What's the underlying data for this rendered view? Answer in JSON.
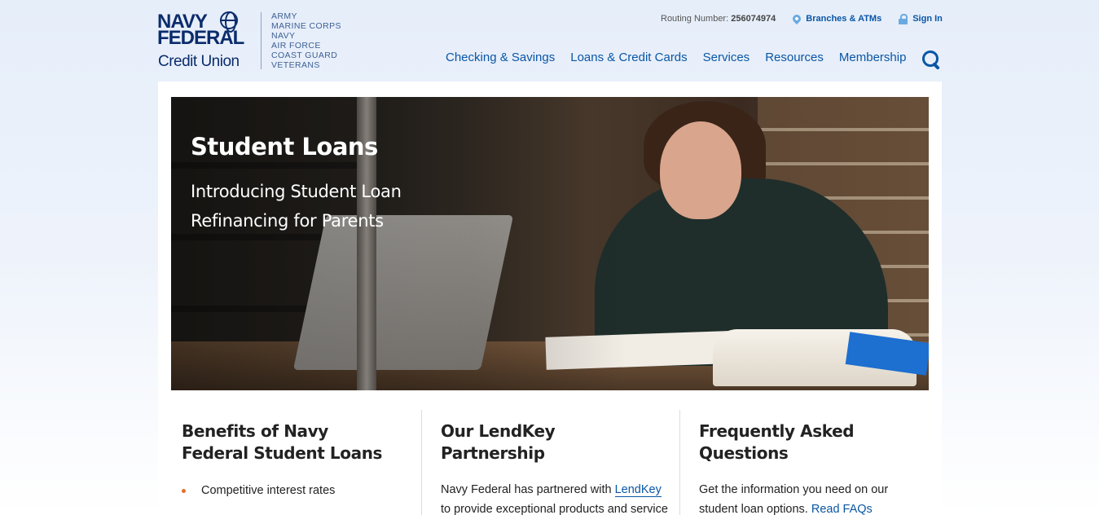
{
  "logo": {
    "line1": "NAVY",
    "line2": "FEDERAL",
    "line3": "Credit Union",
    "branches": [
      "ARMY",
      "MARINE CORPS",
      "NAVY",
      "AIR FORCE",
      "COAST GUARD",
      "VETERANS"
    ]
  },
  "utility": {
    "routing_label": "Routing Number:",
    "routing_number": "256074974",
    "branches_link": "Branches & ATMs",
    "signin_link": "Sign In"
  },
  "nav": {
    "items": [
      "Checking & Savings",
      "Loans & Credit Cards",
      "Services",
      "Resources",
      "Membership"
    ]
  },
  "hero": {
    "title": "Student Loans",
    "subtitle": "Introducing Student Loan Refinancing for Parents"
  },
  "columns": {
    "benefits": {
      "title": "Benefits of Navy Federal Student Loans",
      "items": [
        "Competitive interest rates"
      ]
    },
    "lendkey": {
      "title": "Our LendKey Partnership",
      "text_before": "Navy Federal has partnered with ",
      "link": "LendKey",
      "text_after": " to provide exceptional products and service to help you invest"
    },
    "faq": {
      "title": "Frequently Asked Questions",
      "text": "Get the information you need on our student loan options. ",
      "link": "Read FAQs"
    }
  },
  "colors": {
    "brand_navy": "#0b2c6b",
    "link_blue": "#0a56a5",
    "bullet_orange": "#e0712c"
  }
}
